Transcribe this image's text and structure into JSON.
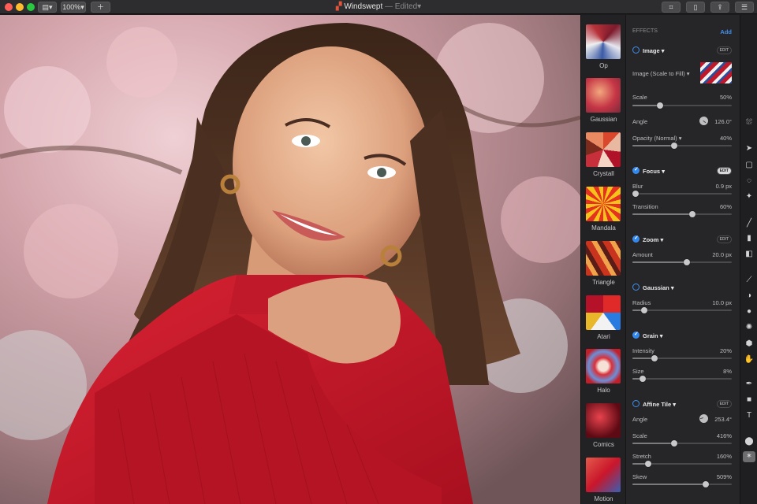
{
  "window": {
    "zoom": "100%",
    "document_title": "Windswept",
    "edited_label": "— Edited"
  },
  "icons": {
    "sidebar_toggle": "sidebar-icon",
    "add": "plus-icon",
    "crop": "crop-icon",
    "new_doc": "document-icon",
    "share": "share-icon",
    "adjust": "sliders-icon"
  },
  "effects_strip": [
    {
      "label": "Op"
    },
    {
      "label": "Gaussian"
    },
    {
      "label": "Crystall"
    },
    {
      "label": "Mandala"
    },
    {
      "label": "Triangle"
    },
    {
      "label": "Atari"
    },
    {
      "label": "Halo"
    },
    {
      "label": "Comics"
    },
    {
      "label": "Motion"
    }
  ],
  "inspector": {
    "header": "EFFECTS",
    "add_label": "Add",
    "edit_label": "EDIT",
    "image": {
      "title": "Image",
      "source_label": "Image (Scale to Fill)",
      "scale_label": "Scale",
      "scale_value": "50%",
      "scale_level": 0.28,
      "angle_label": "Angle",
      "angle_value": "126.0°",
      "opacity_label": "Opacity (Normal)",
      "opacity_value": "40%",
      "opacity_level": 0.42
    },
    "focus": {
      "title": "Focus",
      "blur_label": "Blur",
      "blur_value": "0.9 px",
      "blur_level": 0.03,
      "transition_label": "Transition",
      "transition_value": "60%",
      "transition_level": 0.6
    },
    "zoom": {
      "title": "Zoom",
      "amount_label": "Amount",
      "amount_value": "20.0 px",
      "amount_level": 0.55
    },
    "gaussian": {
      "title": "Gaussian",
      "radius_label": "Radius",
      "radius_value": "10.0 px",
      "radius_level": 0.12
    },
    "grain": {
      "title": "Grain",
      "intensity_label": "Intensity",
      "intensity_value": "20%",
      "intensity_level": 0.22,
      "size_label": "Size",
      "size_value": "8%",
      "size_level": 0.1
    },
    "affine": {
      "title": "Affine Tile",
      "angle_label": "Angle",
      "angle_value": "253.4°",
      "scale_label": "Scale",
      "scale_value": "416%",
      "scale_level": 0.42,
      "stretch_label": "Stretch",
      "stretch_value": "160%",
      "stretch_level": 0.16,
      "skew_label": "Skew",
      "skew_value": "509%",
      "skew_level": 0.74
    }
  },
  "tools": [
    "paint-bucket-icon",
    "pointer-icon",
    "rect-select-icon",
    "lasso-icon",
    "magic-wand-icon",
    "pen-brush-icon",
    "fill-icon",
    "eraser-icon",
    "smudge-icon",
    "clone-icon",
    "blur-icon",
    "sharpen-icon",
    "hand-icon",
    "pen-tool-icon",
    "shape-icon",
    "text-icon",
    "color-icon",
    "effects-icon"
  ],
  "colors": {
    "accent": "#2f87f0",
    "panel": "#262628",
    "sweater": "#c8192c"
  }
}
